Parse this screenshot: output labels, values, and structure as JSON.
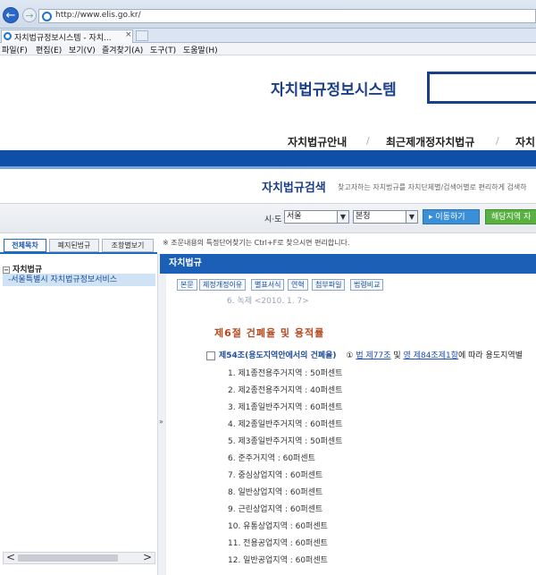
{
  "browser": {
    "url": "http://www.elis.go.kr/",
    "tab_title": "자치법규정보시스템 - 자치...",
    "tab_close": "×",
    "back_glyph": "←",
    "forward_glyph": "→",
    "menu": [
      "파일(F)",
      "편집(E)",
      "보기(V)",
      "즐겨찾기(A)",
      "도구(T)",
      "도움말(H)"
    ]
  },
  "site": {
    "title": "자치법규정보시스템",
    "gnb": [
      "자치법규안내",
      "최근제개정자치법규",
      "자치"
    ],
    "gnb_sep": "/"
  },
  "search": {
    "heading": "자치법규검색",
    "desc": "찾고자하는 자치법규를 자치단체별/검색어별로 편리하게 검색하",
    "region_label": "시·도",
    "region_value": "서울",
    "sub_value": "본청",
    "move_button": "▸ 이동하기",
    "local_button": "해당지역 자"
  },
  "left": {
    "tabs": [
      "전체목차",
      "폐지된법규",
      "조항별보기"
    ],
    "tree_root": "자치법규",
    "tree_toggle": "−",
    "tree_child": "-서울특별시 자치법규정보서비스",
    "scroll_left": "<",
    "scroll_right": ">"
  },
  "main": {
    "notice": "※ 조문내용의 특정단어찾기는 Ctrl+F로 찾으시면 편리합니다.",
    "panel_title": "자치법규",
    "pills": [
      "본문",
      "제정개정이유",
      "별표서식",
      "연혁",
      "첨부파일",
      "법령비교"
    ],
    "cutoff_text": "6. 녹제  <2010. 1. 7>",
    "splitter_grip": "»",
    "section_title": "제6절 건폐율 및 용적률",
    "article": {
      "title": "제54조(용도지역안에서의 건폐율)",
      "circled": "①",
      "link1": "법 제77조",
      "and": "및",
      "link2": "영 제84조제1항",
      "tail": "에 따라 용도지역별"
    },
    "items": [
      "1. 제1종전용주거지역 : 50퍼센트",
      "2. 제2종전용주거지역 : 40퍼센트",
      "3. 제1종일반주거지역 : 60퍼센트",
      "4. 제2종일반주거지역 : 60퍼센트",
      "5. 제3종일반주거지역 : 50퍼센트",
      "6. 준주거지역 : 60퍼센트",
      "7. 중심상업지역 : 60퍼센트",
      "8. 일반상업지역 : 60퍼센트",
      "9. 근린상업지역 : 60퍼센트",
      "10. 유통상업지역 : 60퍼센트",
      "11. 전용공업지역 : 60퍼센트",
      "12. 일반공업지역 : 60퍼센트"
    ]
  }
}
